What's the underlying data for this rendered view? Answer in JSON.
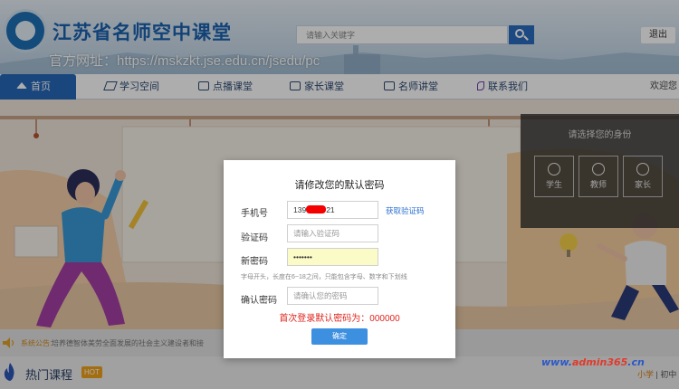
{
  "header": {
    "title": "江苏省名师空中课堂",
    "url_text": "官方网址：https://mskzkt.jse.edu.cn/jsedu/pc",
    "search_placeholder": "请输入关键字",
    "exit_label": "退出",
    "search_icon": "search-icon"
  },
  "nav": {
    "items": [
      {
        "label": "首页",
        "icon": "home-icon",
        "active": true
      },
      {
        "label": "学习空间",
        "icon": "graduation-cap-icon"
      },
      {
        "label": "点播课堂",
        "icon": "play-icon"
      },
      {
        "label": "家长课堂",
        "icon": "book-icon"
      },
      {
        "label": "名师讲堂",
        "icon": "play-icon"
      },
      {
        "label": "联系我们",
        "icon": "phone-icon"
      }
    ],
    "welcome": "欢迎您"
  },
  "role_panel": {
    "title": "请选择您的身份",
    "roles": [
      "学生",
      "教师",
      "家长"
    ]
  },
  "notice": {
    "label": "系统公告：",
    "text": "培养德智体美劳全面发展的社会主义建设者和接"
  },
  "hot": {
    "title": "热门课程",
    "badge": "HOT",
    "grade_current": "小学",
    "grade_sep": " | ",
    "grade_other": "初中"
  },
  "watermark": {
    "prefix": "www.",
    "main": "admin365",
    "suffix": ".cn"
  },
  "modal": {
    "title": "请修改您的默认密码",
    "phone_label": "手机号",
    "phone_prefix": "139",
    "phone_suffix": "21",
    "get_code_label": "获取验证码",
    "code_label": "验证码",
    "code_placeholder": "请输入验证码",
    "new_pw_label": "新密码",
    "new_pw_value": "•••••••",
    "hint": "字母开头，长度在6~18之间，只能包含字母、数字和下划线",
    "confirm_pw_label": "确认密码",
    "confirm_pw_placeholder": "请确认您的密码",
    "default_pw_notice": "首次登录默认密码为：000000",
    "confirm_button": "确定"
  },
  "colors": {
    "brand_blue": "#2668b8",
    "alert_red": "#e0241c",
    "link_blue": "#2a6fd0",
    "hot_orange": "#f1a31a"
  }
}
